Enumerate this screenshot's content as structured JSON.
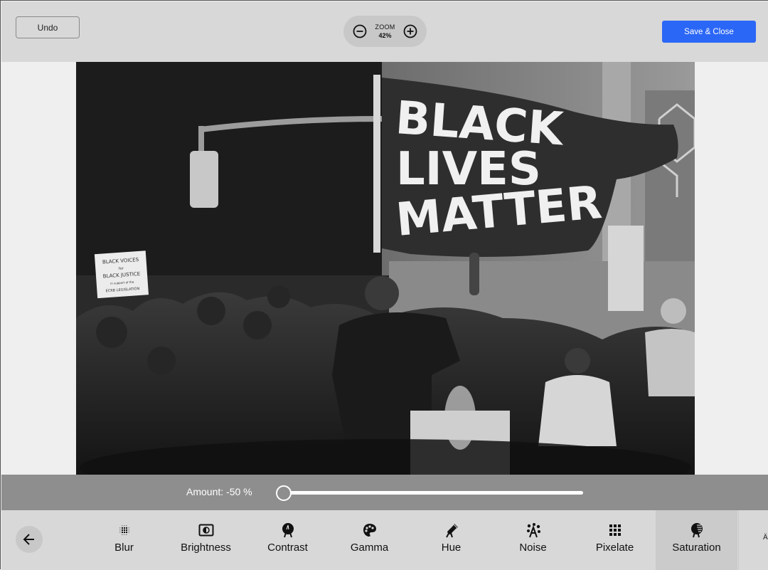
{
  "topbar": {
    "undo_label": "Undo",
    "zoom": {
      "label": "ZOOM",
      "value": "42%",
      "zoom_out_icon": "minus-circle-icon",
      "zoom_in_icon": "plus-circle-icon"
    },
    "save_label": "Save & Close",
    "save_color": "#2b67f6"
  },
  "canvas": {
    "image_description": "Black-and-white protest photo: a man speaking into a microphone beneath a waving 'BLACK LIVES MATTER' flag, crowd around him, traffic light in background",
    "flag_text": [
      "BLACK",
      "LIVES",
      "MATTER"
    ],
    "sign_text": [
      "BLACK VOICES",
      "for",
      "BLACK JUSTICE",
      "in support of the",
      "ECRB LEGISLATION"
    ]
  },
  "adjustment": {
    "label": "Amount: -50 %",
    "value_percent": -50,
    "min": -50,
    "max": 50
  },
  "toolbar": {
    "back_icon": "arrow-left-icon",
    "tools": [
      {
        "label": "Blur",
        "icon": "blur-icon",
        "active": false
      },
      {
        "label": "Brightness",
        "icon": "brightness-icon",
        "active": false
      },
      {
        "label": "Contrast",
        "icon": "contrast-icon",
        "active": false
      },
      {
        "label": "Gamma",
        "icon": "palette-icon",
        "active": false
      },
      {
        "label": "Hue",
        "icon": "eyedropper-icon",
        "active": false
      },
      {
        "label": "Noise",
        "icon": "noise-icon",
        "active": false
      },
      {
        "label": "Pixelate",
        "icon": "grid-icon",
        "active": false
      },
      {
        "label": "Saturation",
        "icon": "saturation-icon",
        "active": true
      }
    ],
    "overflow_glyph": "Ä"
  }
}
